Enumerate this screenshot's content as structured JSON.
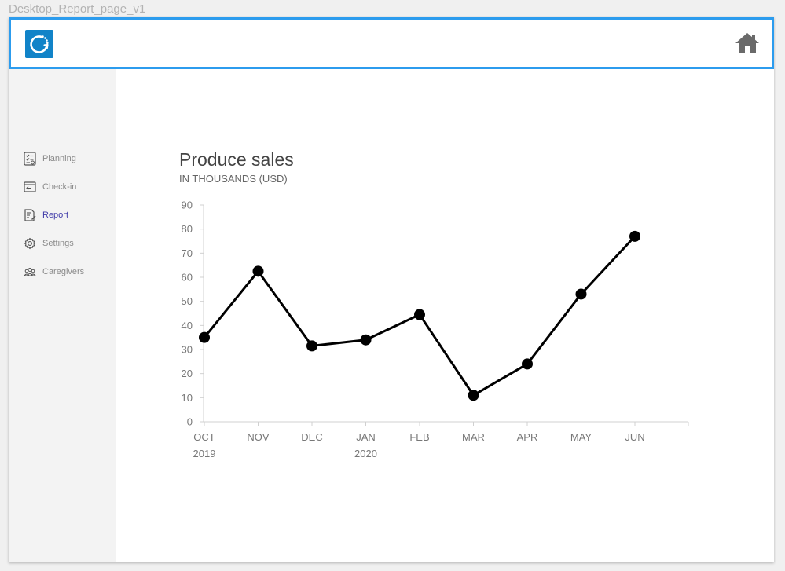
{
  "frame_title": "Desktop_Report_page_v1",
  "header": {
    "logo_icon": "refresh-logo-icon",
    "home_icon": "home-icon"
  },
  "sidebar": {
    "items": [
      {
        "label": "Planning",
        "icon": "checklist-icon",
        "active": false
      },
      {
        "label": "Check-in",
        "icon": "login-icon",
        "active": false
      },
      {
        "label": "Report",
        "icon": "report-icon",
        "active": true
      },
      {
        "label": "Settings",
        "icon": "gear-icon",
        "active": false
      },
      {
        "label": "Caregivers",
        "icon": "people-icon",
        "active": false
      }
    ]
  },
  "colors": {
    "accent": "#2c9cee",
    "logo_bg": "#1183c8",
    "active_nav": "#3f3aa8",
    "sidebar_bg": "#f3f3f3"
  },
  "chart_data": {
    "type": "line",
    "title": "Produce sales",
    "subtitle": "IN THOUSANDS (USD)",
    "categories": [
      "OCT",
      "NOV",
      "DEC",
      "JAN",
      "FEB",
      "MAR",
      "APR",
      "MAY",
      "JUN"
    ],
    "category_sublabels": [
      "2019",
      "",
      "",
      "2020",
      "",
      "",
      "",
      "",
      ""
    ],
    "series": [
      {
        "values": [
          35,
          62.5,
          31.5,
          34,
          44.5,
          11,
          24,
          53,
          77
        ]
      }
    ],
    "ylim": [
      0,
      90
    ],
    "yticks": [
      0,
      10,
      20,
      30,
      40,
      50,
      60,
      70,
      80,
      90
    ],
    "xlabel": "",
    "ylabel": "",
    "grid": false,
    "line_color": "#000000"
  }
}
